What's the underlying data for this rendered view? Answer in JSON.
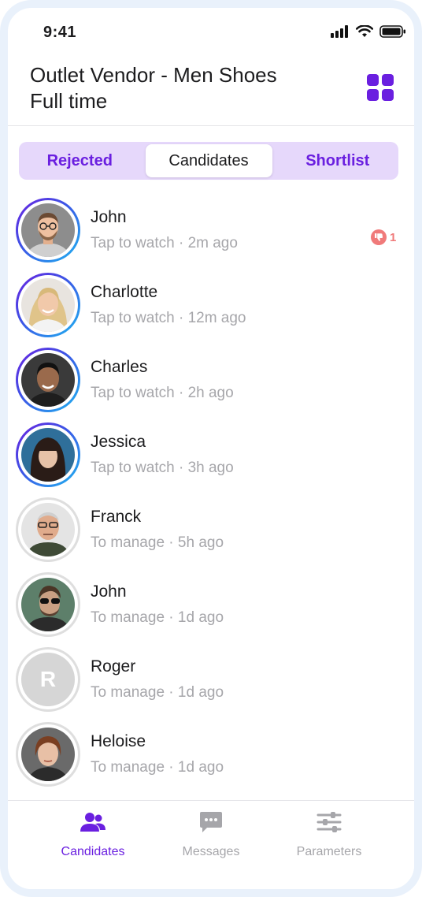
{
  "status_bar": {
    "time": "9:41"
  },
  "header": {
    "job_title": "Outlet Vendor - Men Shoes",
    "job_type": "Full time"
  },
  "tabs": [
    {
      "label": "Rejected",
      "active": false
    },
    {
      "label": "Candidates",
      "active": true
    },
    {
      "label": "Shortlist",
      "active": false
    }
  ],
  "candidates": [
    {
      "name": "John",
      "status": "Tap to watch",
      "time": "2m ago",
      "avatar": "photo",
      "badge_count": "1"
    },
    {
      "name": "Charlotte",
      "status": "Tap to watch",
      "time": "12m ago",
      "avatar": "photo"
    },
    {
      "name": "Charles",
      "status": "Tap to watch",
      "time": "2h ago",
      "avatar": "photo"
    },
    {
      "name": "Jessica",
      "status": "Tap to watch",
      "time": "3h ago",
      "avatar": "photo"
    },
    {
      "name": "Franck",
      "status": "To manage",
      "time": "5h ago",
      "avatar": "photo"
    },
    {
      "name": "John",
      "status": "To manage",
      "time": "1d ago",
      "avatar": "photo"
    },
    {
      "name": "Roger",
      "status": "To manage",
      "time": "1d ago",
      "avatar": "initial",
      "initial": "R"
    },
    {
      "name": "Heloise",
      "status": "To manage",
      "time": "1d ago",
      "avatar": "photo"
    }
  ],
  "bottom_nav": [
    {
      "label": "Candidates",
      "icon": "people-icon",
      "active": true
    },
    {
      "label": "Messages",
      "icon": "chat-bubble-icon",
      "active": false
    },
    {
      "label": "Parameters",
      "icon": "sliders-icon",
      "active": false
    }
  ],
  "colors": {
    "accent": "#6a1fe0",
    "tab_bg": "#e6d8fb",
    "ring_gradient_start": "#6a1fe0",
    "ring_gradient_end": "#1fb6f0",
    "badge": "#f07a7a",
    "muted_text": "#a6a6aa"
  }
}
